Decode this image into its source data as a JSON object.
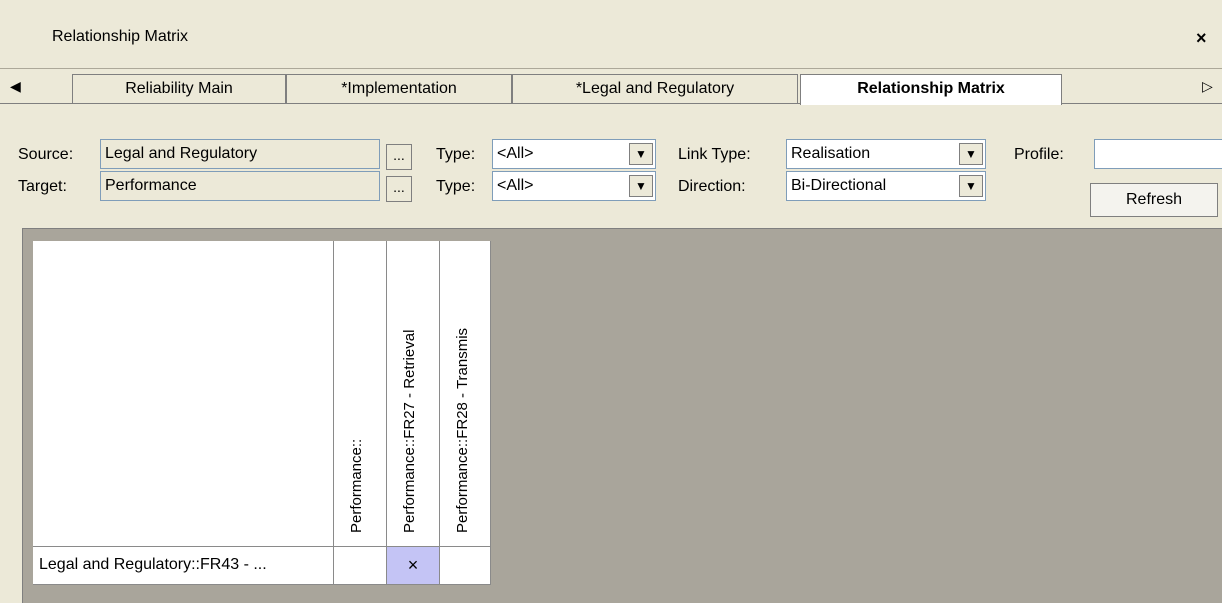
{
  "window": {
    "title": "Relationship Matrix",
    "close_glyph": "×"
  },
  "tabs": [
    {
      "label": "Reliability Main"
    },
    {
      "label": "*Implementation"
    },
    {
      "label": "*Legal and Regulatory"
    },
    {
      "label": "Relationship Matrix",
      "active": true
    }
  ],
  "tab_scroll": {
    "left": "◀",
    "right": "▷"
  },
  "filters": {
    "source_label": "Source:",
    "source_value": "Legal and Regulatory",
    "target_label": "Target:",
    "target_value": "Performance",
    "browse_label": "...",
    "type_label": "Type:",
    "source_type": "<All>",
    "target_type": "<All>",
    "link_type_label": "Link Type:",
    "link_type": "Realisation",
    "direction_label": "Direction:",
    "direction": "Bi-Directional",
    "profile_label": "Profile:",
    "profile_value": "",
    "refresh_label": "Refresh"
  },
  "matrix": {
    "columns": [
      {
        "header": "Performance::"
      },
      {
        "header": "Performance::FR27 - Retrieval"
      },
      {
        "header": "Performance::FR28 - Transmis"
      }
    ],
    "rows": [
      {
        "header": "Legal and Regulatory::FR43 - ...",
        "cells": [
          "",
          "×",
          ""
        ]
      }
    ],
    "highlight_color": "#c4c4f5"
  },
  "colors": {
    "panel": "#ece9d8",
    "matrix_bg": "#a9a59b",
    "field_border": "#7f9db9"
  }
}
